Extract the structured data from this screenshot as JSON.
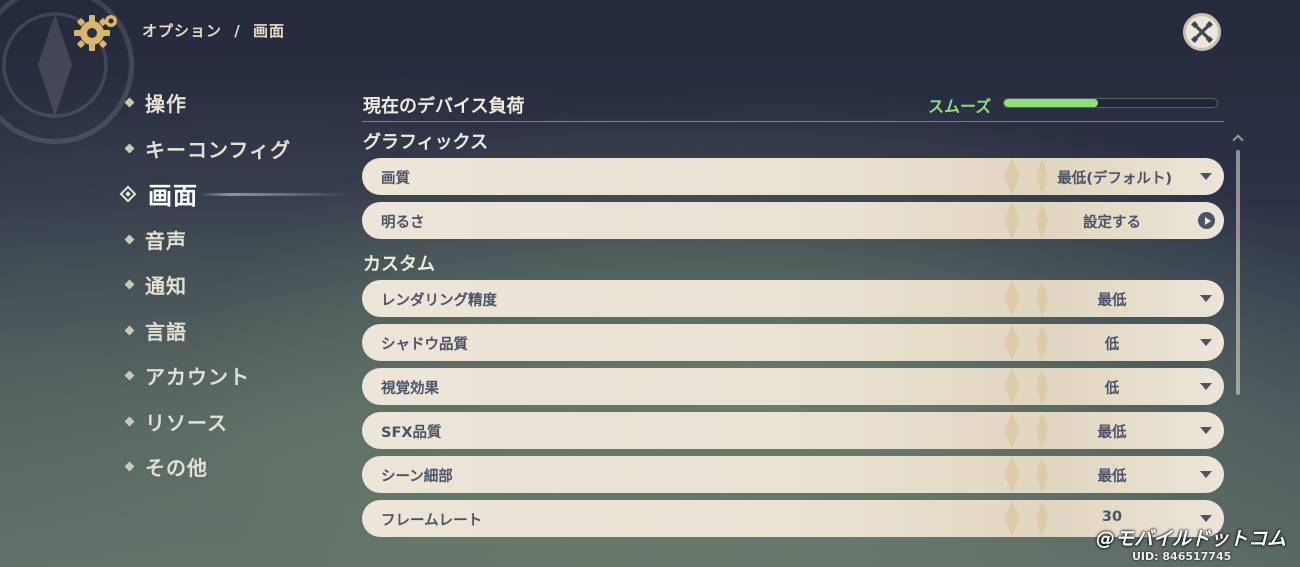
{
  "header": {
    "breadcrumb_parent": "オプション",
    "breadcrumb_sep": "/",
    "breadcrumb_current": "画面"
  },
  "sidebar": {
    "items": [
      {
        "label": "操作"
      },
      {
        "label": "キーコンフィグ"
      },
      {
        "label": "画面",
        "active": true
      },
      {
        "label": "音声"
      },
      {
        "label": "通知"
      },
      {
        "label": "言語"
      },
      {
        "label": "アカウント"
      },
      {
        "label": "リソース"
      },
      {
        "label": "その他"
      }
    ]
  },
  "device_load": {
    "title": "現在のデバイス負荷",
    "status": "スムーズ",
    "level_fraction": 0.44,
    "status_color": "#8fe07a"
  },
  "graphics": {
    "title": "グラフィックス",
    "rows": [
      {
        "label": "画質",
        "value": "最低(デフォルト)",
        "control": "dropdown"
      },
      {
        "label": "明るさ",
        "value": "設定する",
        "control": "link"
      }
    ]
  },
  "custom": {
    "title": "カスタム",
    "rows": [
      {
        "label": "レンダリング精度",
        "value": "最低",
        "control": "dropdown"
      },
      {
        "label": "シャドウ品質",
        "value": "低",
        "control": "dropdown"
      },
      {
        "label": "視覚効果",
        "value": "低",
        "control": "dropdown"
      },
      {
        "label": "SFX品質",
        "value": "最低",
        "control": "dropdown"
      },
      {
        "label": "シーン細部",
        "value": "最低",
        "control": "dropdown"
      },
      {
        "label": "フレームレート",
        "value": "30",
        "control": "dropdown"
      }
    ]
  },
  "watermark": "@モバイルドットコム",
  "uid": "UID: 846517745",
  "icons": {
    "settings": "gear-icon",
    "close": "close-icon",
    "dropdown": "caret-down-icon",
    "link": "arrow-right-circle-icon"
  },
  "colors": {
    "row_bg": "#ece5d8",
    "row_text": "#4a5367",
    "accent_green": "#8fe07a"
  }
}
